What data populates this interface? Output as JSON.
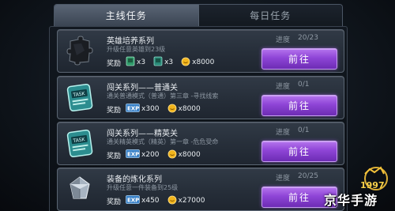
{
  "tabs": [
    {
      "label": "主线任务",
      "active": true
    },
    {
      "label": "每日任务",
      "active": false
    }
  ],
  "quests": [
    {
      "title": "英雄培养系列",
      "desc": "升级任意英雄到23级",
      "progress_label": "进度",
      "progress": "20/23",
      "rewards_label": "奖励",
      "rewards": [
        {
          "icon": "green-card-icon",
          "text": "x3"
        },
        {
          "icon": "blue-card-icon",
          "text": "x3"
        },
        {
          "icon": "gold-coin-icon",
          "text": "x8000"
        }
      ],
      "button": "前往",
      "icon": "puzzle-piece-icon"
    },
    {
      "title": "闯关系列——普通关",
      "desc": "通关普通模式（普通）第三章 -寻找线索",
      "progress_label": "进度",
      "progress": "0/1",
      "rewards_label": "奖励",
      "rewards": [
        {
          "icon": "exp-icon",
          "text": "x300"
        },
        {
          "icon": "gold-coin-icon",
          "text": "x8000"
        }
      ],
      "button": "前往",
      "icon": "task-tablet-icon"
    },
    {
      "title": "闯关系列——精英关",
      "desc": "通关精英模式（精英）第一章 -危危受命",
      "progress_label": "进度",
      "progress": "0/1",
      "rewards_label": "奖励",
      "rewards": [
        {
          "icon": "exp-icon",
          "text": "x200"
        },
        {
          "icon": "gold-coin-icon",
          "text": "x8000"
        }
      ],
      "button": "前往",
      "icon": "task-tablet-icon"
    },
    {
      "title": "装备的炼化系列",
      "desc": "升级任意一件装备到25级",
      "progress_label": "进度",
      "progress": "20/25",
      "rewards_label": "奖励",
      "rewards": [
        {
          "icon": "exp-icon",
          "text": "x450"
        },
        {
          "icon": "gold-coin-icon",
          "text": "x27000"
        }
      ],
      "button": "前往",
      "icon": "crystal-gem-icon"
    }
  ],
  "watermark": {
    "text": "京华手游",
    "logo_number": "1997"
  },
  "colors": {
    "accent": "#8e45d6",
    "gold": "#f2b51c",
    "exp": "#3a82c8"
  }
}
